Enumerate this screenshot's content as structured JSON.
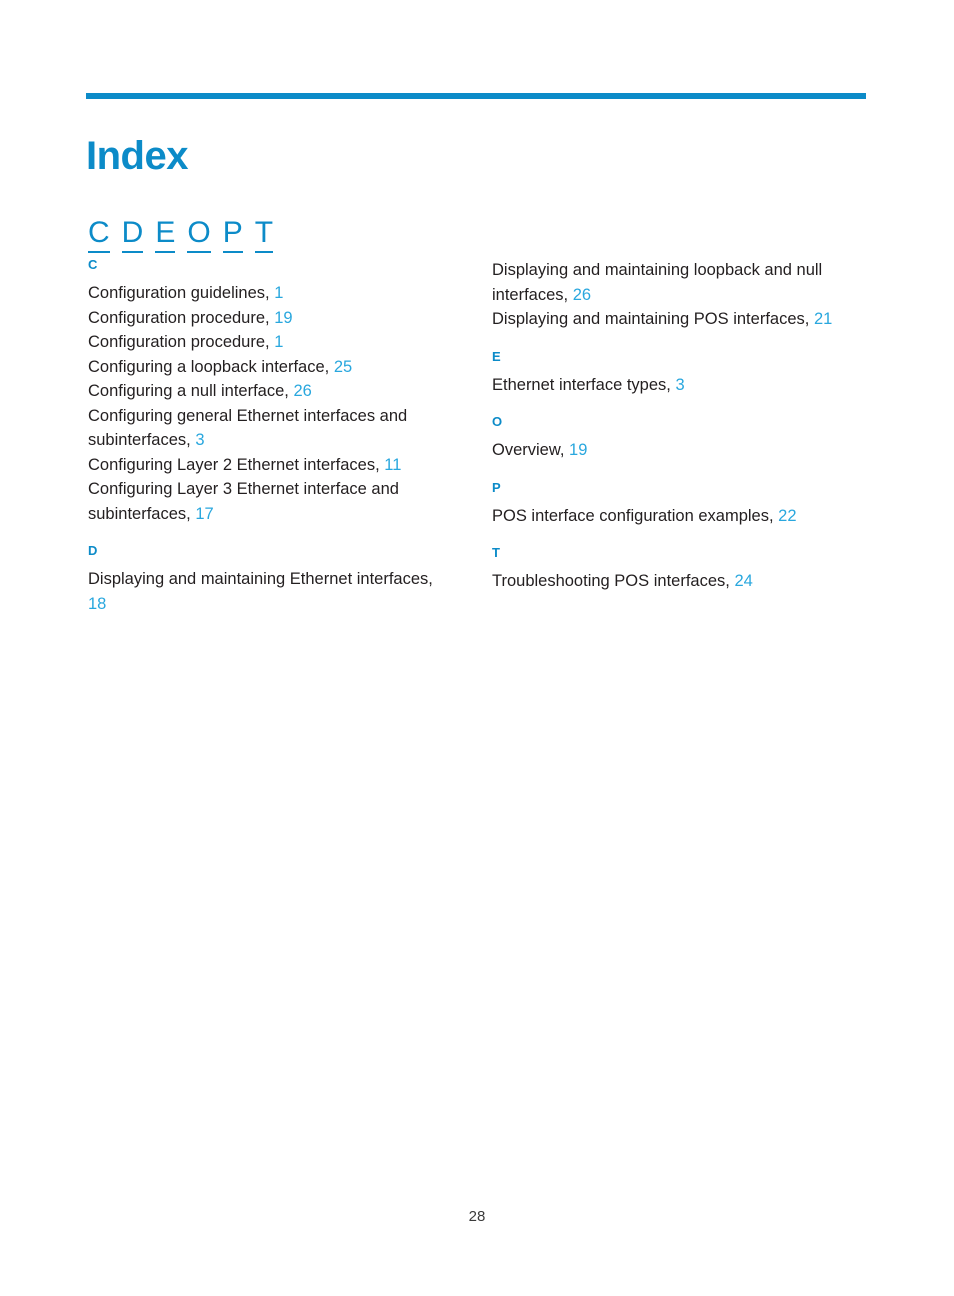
{
  "page": {
    "title": "Index",
    "folio": "28",
    "accent_color": "#0c8bc8",
    "link_color": "#29a7de",
    "text_color": "#231f20"
  },
  "letter_nav": [
    {
      "label": "C"
    },
    {
      "label": "D"
    },
    {
      "label": "E"
    },
    {
      "label": "O"
    },
    {
      "label": "P"
    },
    {
      "label": "T"
    }
  ],
  "columns": [
    {
      "sections": [
        {
          "letter": "C",
          "entries": [
            {
              "text": "Configuration guidelines,",
              "page": "1"
            },
            {
              "text": "Configuration procedure,",
              "page": "19"
            },
            {
              "text": "Configuration procedure,",
              "page": "1"
            },
            {
              "text": "Configuring a loopback interface,",
              "page": "25"
            },
            {
              "text": "Configuring a null interface,",
              "page": "26"
            },
            {
              "text": "Configuring general Ethernet interfaces and subinterfaces,",
              "page": "3"
            },
            {
              "text": "Configuring Layer 2 Ethernet interfaces,",
              "page": "11"
            },
            {
              "text": "Configuring Layer 3 Ethernet interface and subinterfaces,",
              "page": "17"
            }
          ]
        },
        {
          "letter": "D",
          "entries": [
            {
              "text": "Displaying and maintaining Ethernet interfaces,",
              "page": "18"
            }
          ]
        }
      ]
    },
    {
      "sections": [
        {
          "letter": "",
          "entries": [
            {
              "text": "Displaying and maintaining loopback and null interfaces,",
              "page": "26"
            },
            {
              "text": "Displaying and maintaining POS interfaces,",
              "page": "21"
            }
          ]
        },
        {
          "letter": "E",
          "entries": [
            {
              "text": "Ethernet interface types,",
              "page": "3"
            }
          ]
        },
        {
          "letter": "O",
          "entries": [
            {
              "text": "Overview,",
              "page": "19"
            }
          ]
        },
        {
          "letter": "P",
          "entries": [
            {
              "text": "POS interface configuration examples,",
              "page": "22"
            }
          ]
        },
        {
          "letter": "T",
          "entries": [
            {
              "text": "Troubleshooting POS interfaces,",
              "page": "24"
            }
          ]
        }
      ]
    }
  ]
}
